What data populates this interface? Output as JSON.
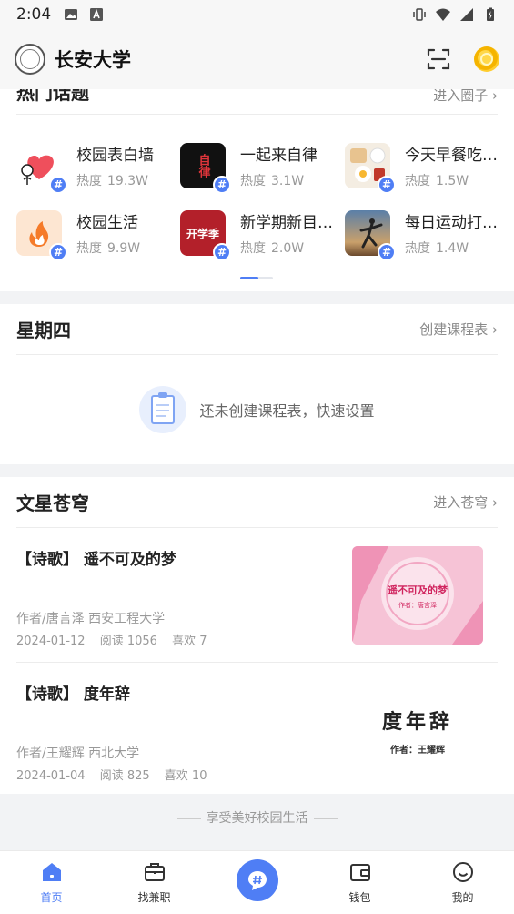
{
  "status_bar": {
    "time": "2:04"
  },
  "header": {
    "title": "长安大学"
  },
  "topics": {
    "section_title": "热门话题",
    "link": "进入圈子 ›",
    "items": [
      {
        "name": "校园表白墙",
        "heat_label": "热度",
        "heat": "19.3W"
      },
      {
        "name": "一起来自律",
        "heat_label": "热度",
        "heat": "3.1W",
        "thumb_text": "自律"
      },
      {
        "name": "今天早餐吃…",
        "heat_label": "热度",
        "heat": "1.5W"
      },
      {
        "name": "校园生活",
        "heat_label": "热度",
        "heat": "9.9W"
      },
      {
        "name": "新学期新目…",
        "heat_label": "热度",
        "heat": "2.0W",
        "thumb_text": "开学季"
      },
      {
        "name": "每日运动打…",
        "heat_label": "热度",
        "heat": "1.4W"
      }
    ]
  },
  "schedule": {
    "title": "星期四",
    "link": "创建课程表 ›",
    "empty_text": "还未创建课程表，快速设置"
  },
  "stars": {
    "title": "文星苍穹",
    "link": "进入苍穹 ›",
    "articles": [
      {
        "title": "【诗歌】 遥不可及的梦",
        "author": "作者/唐言泽 西安工程大学",
        "date": "2024-01-12",
        "reads": "阅读 1056",
        "likes": "喜欢 7",
        "cover_text": "遥不可及的梦",
        "cover_sub": "作者：唐言泽"
      },
      {
        "title": "【诗歌】 度年辞",
        "author": "作者/王耀辉 西北大学",
        "date": "2024-01-04",
        "reads": "阅读 825",
        "likes": "喜欢 10",
        "cover_text": "度年辞",
        "cover_sub": "作者：王耀辉"
      }
    ]
  },
  "footer_note": "享受美好校园生活",
  "nav": {
    "home": "首页",
    "jobs": "找兼职",
    "wallet": "钱包",
    "mine": "我的"
  },
  "colors": {
    "accent": "#4f7ef5",
    "background": "#f2f3f5"
  }
}
